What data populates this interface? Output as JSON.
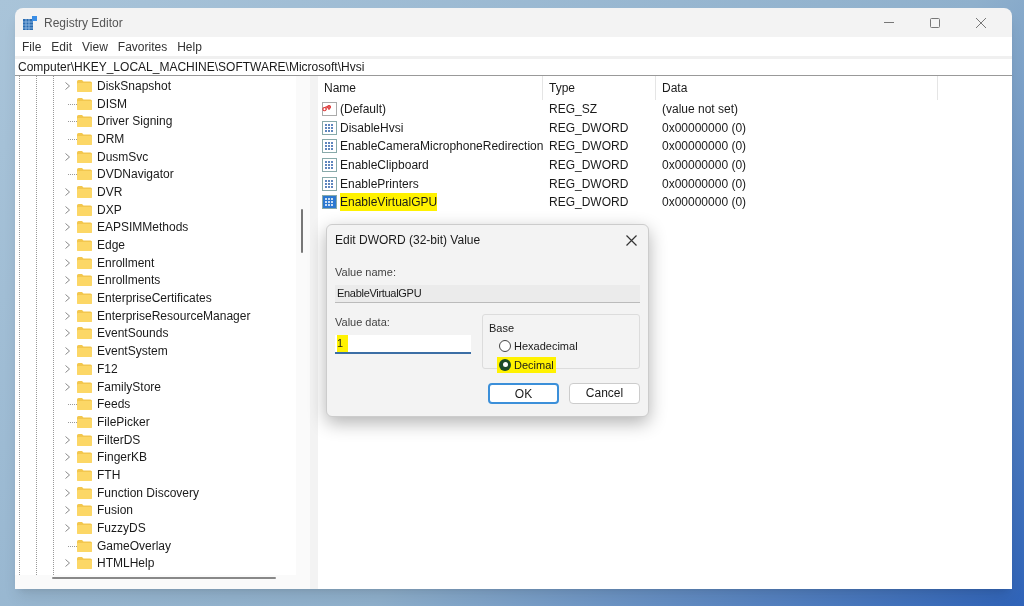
{
  "window": {
    "title": "Registry Editor"
  },
  "menu": [
    "File",
    "Edit",
    "View",
    "Favorites",
    "Help"
  ],
  "address": "Computer\\HKEY_LOCAL_MACHINE\\SOFTWARE\\Microsoft\\Hvsi",
  "tree": [
    {
      "label": "DiskSnapshot",
      "expandable": true
    },
    {
      "label": "DISM",
      "expandable": false
    },
    {
      "label": "Driver Signing",
      "expandable": false
    },
    {
      "label": "DRM",
      "expandable": false
    },
    {
      "label": "DusmSvc",
      "expandable": true
    },
    {
      "label": "DVDNavigator",
      "expandable": false
    },
    {
      "label": "DVR",
      "expandable": true
    },
    {
      "label": "DXP",
      "expandable": true
    },
    {
      "label": "EAPSIMMethods",
      "expandable": true
    },
    {
      "label": "Edge",
      "expandable": true
    },
    {
      "label": "Enrollment",
      "expandable": true
    },
    {
      "label": "Enrollments",
      "expandable": true
    },
    {
      "label": "EnterpriseCertificates",
      "expandable": true
    },
    {
      "label": "EnterpriseResourceManager",
      "expandable": true
    },
    {
      "label": "EventSounds",
      "expandable": true
    },
    {
      "label": "EventSystem",
      "expandable": true
    },
    {
      "label": "F12",
      "expandable": true
    },
    {
      "label": "FamilyStore",
      "expandable": true
    },
    {
      "label": "Feeds",
      "expandable": false
    },
    {
      "label": "FilePicker",
      "expandable": false
    },
    {
      "label": "FilterDS",
      "expandable": true
    },
    {
      "label": "FingerKB",
      "expandable": true
    },
    {
      "label": "FTH",
      "expandable": true
    },
    {
      "label": "Function Discovery",
      "expandable": true
    },
    {
      "label": "Fusion",
      "expandable": true
    },
    {
      "label": "FuzzyDS",
      "expandable": true
    },
    {
      "label": "GameOverlay",
      "expandable": false
    },
    {
      "label": "HTMLHelp",
      "expandable": true
    }
  ],
  "table": {
    "columns": [
      "Name",
      "Type",
      "Data"
    ],
    "rows": [
      {
        "kind": "string",
        "name": "(Default)",
        "type": "REG_SZ",
        "data": "(value not set)",
        "selected": false
      },
      {
        "kind": "dword",
        "name": "DisableHvsi",
        "type": "REG_DWORD",
        "data": "0x00000000 (0)",
        "selected": false
      },
      {
        "kind": "dword",
        "name": "EnableCameraMicrophoneRedirection",
        "type": "REG_DWORD",
        "data": "0x00000000 (0)",
        "selected": false
      },
      {
        "kind": "dword",
        "name": "EnableClipboard",
        "type": "REG_DWORD",
        "data": "0x00000000 (0)",
        "selected": false
      },
      {
        "kind": "dword",
        "name": "EnablePrinters",
        "type": "REG_DWORD",
        "data": "0x00000000 (0)",
        "selected": false
      },
      {
        "kind": "dword",
        "name": "EnableVirtualGPU",
        "type": "REG_DWORD",
        "data": "0x00000000 (0)",
        "selected": true
      }
    ]
  },
  "dialog": {
    "title": "Edit DWORD (32-bit) Value",
    "value_name_label": "Value name:",
    "value_name": "EnableVirtualGPU",
    "value_data_label": "Value data:",
    "value_data": "1",
    "value_data_highlighted": true,
    "base_label": "Base",
    "base_options": [
      {
        "label": "Hexadecimal",
        "selected": false,
        "highlighted": false
      },
      {
        "label": "Decimal",
        "selected": true,
        "highlighted": true
      }
    ],
    "buttons": [
      {
        "label": "OK",
        "default": true
      },
      {
        "label": "Cancel",
        "default": false
      }
    ]
  }
}
